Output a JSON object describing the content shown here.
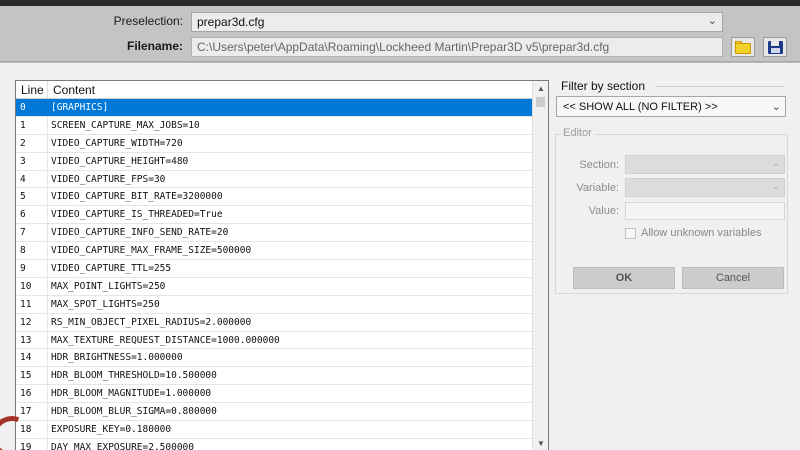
{
  "header": {
    "preselection_label": "Preselection:",
    "preselection_value": "prepar3d.cfg",
    "filename_label": "Filename:",
    "filename_value": "C:\\Users\\peter\\AppData\\Roaming\\Lockheed Martin\\Prepar3D v5\\prepar3d.cfg",
    "open_folder_icon": "folder-icon",
    "save_icon": "floppy-disk-icon"
  },
  "grid": {
    "columns": [
      "Line",
      "Content"
    ],
    "selected_index": 0,
    "rows": [
      {
        "line": "0",
        "content": "[GRAPHICS]"
      },
      {
        "line": "1",
        "content": "SCREEN_CAPTURE_MAX_JOBS=10"
      },
      {
        "line": "2",
        "content": "VIDEO_CAPTURE_WIDTH=720"
      },
      {
        "line": "3",
        "content": "VIDEO_CAPTURE_HEIGHT=480"
      },
      {
        "line": "4",
        "content": "VIDEO_CAPTURE_FPS=30"
      },
      {
        "line": "5",
        "content": "VIDEO_CAPTURE_BIT_RATE=3200000"
      },
      {
        "line": "6",
        "content": "VIDEO_CAPTURE_IS_THREADED=True"
      },
      {
        "line": "7",
        "content": "VIDEO_CAPTURE_INFO_SEND_RATE=20"
      },
      {
        "line": "8",
        "content": "VIDEO_CAPTURE_MAX_FRAME_SIZE=500000"
      },
      {
        "line": "9",
        "content": "VIDEO_CAPTURE_TTL=255"
      },
      {
        "line": "10",
        "content": "MAX_POINT_LIGHTS=250"
      },
      {
        "line": "11",
        "content": "MAX_SPOT_LIGHTS=250"
      },
      {
        "line": "12",
        "content": "RS_MIN_OBJECT_PIXEL_RADIUS=2.000000"
      },
      {
        "line": "13",
        "content": "MAX_TEXTURE_REQUEST_DISTANCE=1000.000000"
      },
      {
        "line": "14",
        "content": "HDR_BRIGHTNESS=1.000000"
      },
      {
        "line": "15",
        "content": "HDR_BLOOM_THRESHOLD=10.500000"
      },
      {
        "line": "16",
        "content": "HDR_BLOOM_MAGNITUDE=1.000000"
      },
      {
        "line": "17",
        "content": "HDR_BLOOM_BLUR_SIGMA=0.800000"
      },
      {
        "line": "18",
        "content": "EXPOSURE_KEY=0.180000"
      },
      {
        "line": "19",
        "content": "DAY_MAX_EXPOSURE=2.500000"
      }
    ]
  },
  "filter": {
    "title": "Filter by section",
    "value": "<< SHOW ALL (NO FILTER) >>"
  },
  "editor": {
    "title": "Editor",
    "section_label": "Section:",
    "variable_label": "Variable:",
    "value_label": "Value:",
    "allow_unknown_label": "Allow unknown variables",
    "ok_label": "OK",
    "cancel_label": "Cancel"
  },
  "colors": {
    "selection": "#0078d7",
    "folder_icon": "#f3cf2a",
    "save_icon": "#1d3a8a"
  }
}
